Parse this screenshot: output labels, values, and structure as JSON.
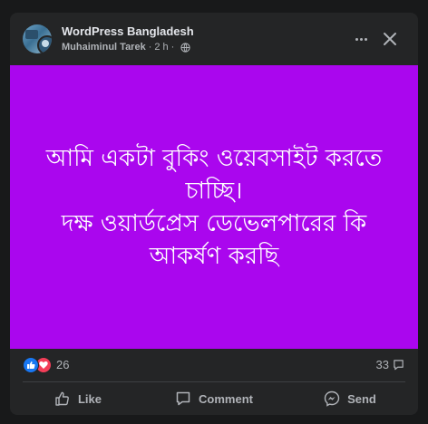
{
  "post": {
    "group_name": "WordPress Bangladesh",
    "author": "Muhaiminul Tarek",
    "time": "2 h",
    "separator": "·",
    "privacy_icon": "globe-icon"
  },
  "banner": {
    "background": "#aa06ee",
    "text_color": "#ffffff",
    "lines": [
      "আমি একটা বুকিং ওয়েবসাইট করতে",
      "চাচ্ছি।",
      "দক্ষ ওয়ার্ডপ্রেস ডেভেলপারের কি",
      "আকর্ষণ করছি"
    ]
  },
  "reactions": {
    "icons": [
      "like-reaction-icon",
      "love-reaction-icon"
    ],
    "count": "26",
    "comments_count": "33"
  },
  "actions": {
    "like": "Like",
    "comment": "Comment",
    "send": "Send"
  }
}
